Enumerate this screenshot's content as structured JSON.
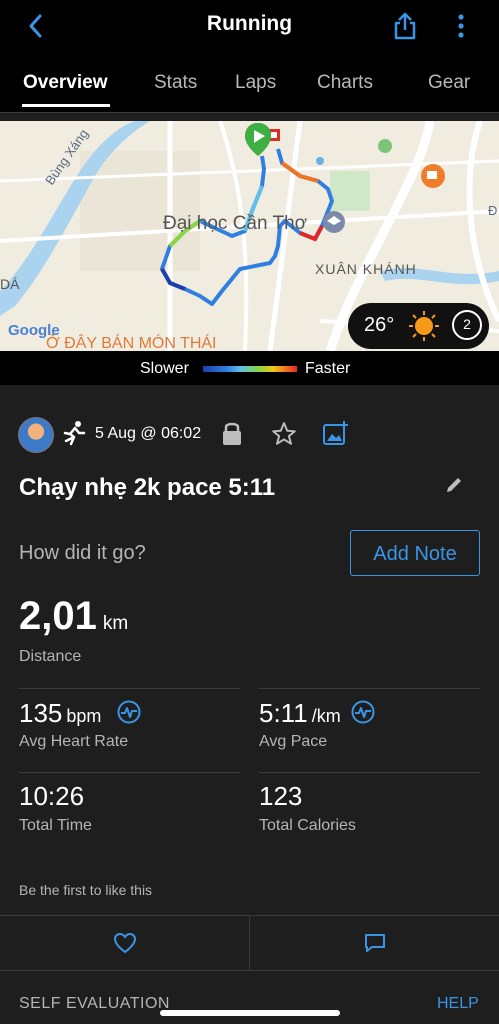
{
  "header": {
    "title": "Running",
    "back_icon": "chevron-left-icon",
    "share_icon": "share-icon",
    "more_icon": "more-vertical-icon",
    "accent": "#3b95e6"
  },
  "tabs": [
    {
      "label": "Overview",
      "active": true
    },
    {
      "label": "Stats",
      "active": false
    },
    {
      "label": "Laps",
      "active": false
    },
    {
      "label": "Charts",
      "active": false
    },
    {
      "label": "Gear",
      "active": false
    }
  ],
  "map": {
    "labels": {
      "river": "Bùng Xáng",
      "university": "Đại học Cần Thơ",
      "district": "XUÂN KHÁNH",
      "left_edge": "DÁ",
      "right_edge": "Đ",
      "bottom_poi": "Ở ĐÂY BÁN MÓN THÁI",
      "google": "Google"
    },
    "weather": {
      "temperature": "26°",
      "wind": "2"
    }
  },
  "pace_legend": {
    "slower": "Slower",
    "faster": "Faster"
  },
  "activity": {
    "date": "5 Aug @ 06:02",
    "name": "Chạy nhẹ 2k pace 5:11",
    "question": "How did it go?",
    "add_note": "Add Note"
  },
  "distance": {
    "value": "2,01",
    "unit": "km",
    "label": "Distance"
  },
  "stats": {
    "heart_rate": {
      "value": "135",
      "unit": "bpm",
      "label": "Avg Heart Rate"
    },
    "pace": {
      "value": "5:11",
      "unit": "/km",
      "label": "Avg Pace"
    },
    "time": {
      "value": "10:26",
      "label": "Total Time"
    },
    "calories": {
      "value": "123",
      "label": "Total Calories"
    }
  },
  "social": {
    "likes_text": "Be the first to like this"
  },
  "footer": {
    "self_evaluation": "SELF EVALUATION",
    "help": "HELP"
  }
}
